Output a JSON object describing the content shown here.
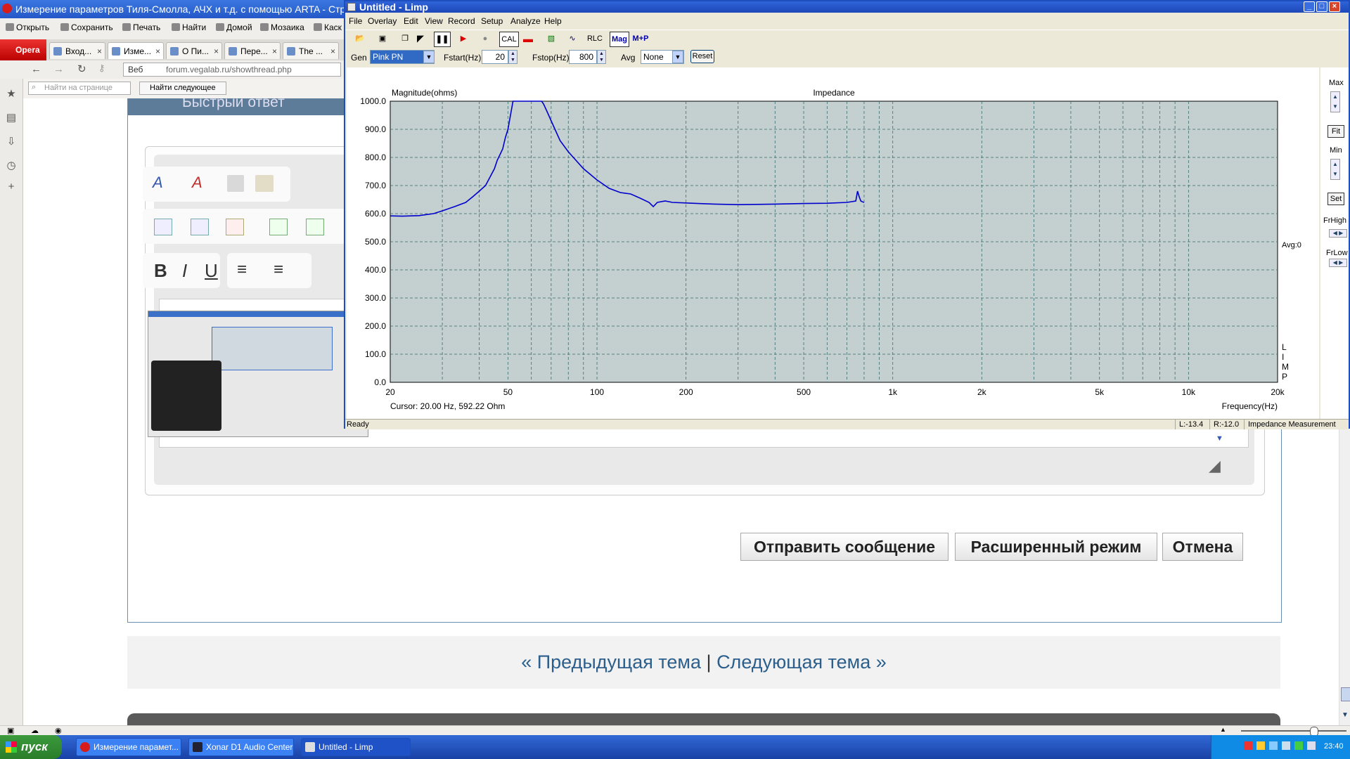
{
  "opera": {
    "title": "Измерение параметров Тиля-Смолла, АЧХ и т.д. с помощью ARTA - Страница",
    "toolbar": [
      "Открыть",
      "Сохранить",
      "Печать",
      "Найти",
      "Домой",
      "Мозаика",
      "Каск"
    ],
    "opera_tab": "Opera",
    "tabs": [
      "Вход...",
      "Изме...",
      "О Пи...",
      "Пере...",
      "The ..."
    ],
    "address_label": "Веб",
    "url": "forum.vegalab.ru/showthread.php",
    "find_placeholder": "Найти на странице",
    "find_next": "Найти следующее",
    "header_text": "Быстрый ответ"
  },
  "page": {
    "buttons": {
      "send": "Отправить сообщение",
      "advanced": "Расширенный режим",
      "cancel": "Отмена"
    },
    "nav": {
      "prev": "« Предыдущая тема",
      "separator": "|",
      "next": "Следующая тема »"
    }
  },
  "limp": {
    "title": "Untitled - Limp",
    "menu": [
      "File",
      "Overlay",
      "Edit",
      "View",
      "Record",
      "Setup",
      "Analyze",
      "Help"
    ],
    "tools": {
      "cal": "CAL",
      "rlc": "RLC",
      "mag": "Mag",
      "mp": "M+P"
    },
    "gen_label": "Gen",
    "gen_value": "Pink PN",
    "fstart_label": "Fstart(Hz)",
    "fstart_value": "20",
    "fstop_label": "Fstop(Hz)",
    "fstop_value": "800",
    "avg_label": "Avg",
    "avg_value": "None",
    "reset": "Reset",
    "right_panel": {
      "max": "Max",
      "fit": "Fit",
      "min": "Min",
      "set": "Set",
      "frhigh": "FrHigh",
      "frlow": "FrLow"
    },
    "status": {
      "ready": "Ready",
      "l": "L:-13.4",
      "r": "R:-12.0",
      "mode": "Impedance Measurement"
    },
    "colors": {
      "plot_bg": "#c4cfd0",
      "curve": "#0000cc",
      "grid": "#3b6e6e"
    }
  },
  "chart_data": {
    "type": "line",
    "title": "Impedance",
    "ylabel": "Magnitude(ohms)",
    "xlabel": "Frequency(Hz)",
    "xscale": "log",
    "xlim": [
      20,
      20000
    ],
    "ylim": [
      0,
      1000
    ],
    "xticks": [
      20,
      50,
      100,
      200,
      500,
      1000,
      2000,
      5000,
      10000,
      20000
    ],
    "xtick_labels": [
      "20",
      "50",
      "100",
      "200",
      "500",
      "1k",
      "2k",
      "5k",
      "10k",
      "20k"
    ],
    "yticks": [
      "0.0",
      "100.0",
      "200.0",
      "300.0",
      "400.0",
      "500.0",
      "600.0",
      "700.0",
      "800.0",
      "900.0",
      "1000.0"
    ],
    "cursor": "Cursor: 20.00 Hz, 592.22 Ohm",
    "avg_label": "Avg:0",
    "side_label": [
      "L",
      "I",
      "M",
      "P"
    ],
    "grid": true,
    "series": [
      {
        "x": [
          20,
          22,
          25,
          28,
          30,
          33,
          36,
          38,
          40,
          42,
          43,
          44,
          45,
          46,
          47,
          48,
          49,
          50,
          51,
          52,
          53,
          54,
          55,
          58,
          62,
          65,
          66,
          68,
          70,
          75,
          80,
          90,
          100,
          110,
          120,
          130,
          140,
          150,
          155,
          160,
          170,
          180,
          200,
          220,
          250,
          300,
          350,
          400,
          500,
          600,
          700,
          750,
          760,
          770,
          780,
          790,
          800
        ],
        "y": [
          592,
          591,
          593,
          600,
          610,
          625,
          640,
          660,
          680,
          700,
          720,
          740,
          760,
          790,
          810,
          830,
          870,
          900,
          950,
          1000,
          1000,
          1000,
          1000,
          1000,
          1000,
          1000,
          990,
          960,
          930,
          860,
          820,
          760,
          720,
          690,
          675,
          670,
          655,
          640,
          625,
          640,
          645,
          640,
          638,
          636,
          634,
          632,
          633,
          634,
          636,
          637,
          640,
          645,
          680,
          660,
          645,
          642,
          640
        ]
      }
    ]
  }
}
